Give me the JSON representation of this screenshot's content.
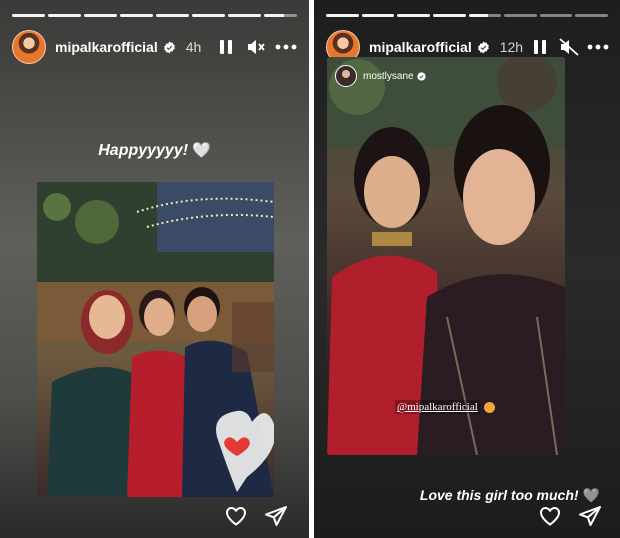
{
  "stories": [
    {
      "username": "mipalkarofficial",
      "time": "4h",
      "caption": "Happyyyyy!",
      "caption_emoji": "🤍",
      "progress_segments": 8,
      "progress_current": 8,
      "audio_state": "muted",
      "playback_state": "playing"
    },
    {
      "username": "mipalkarofficial",
      "time": "12h",
      "reposted_from": "mostlysane",
      "mention": "@mipalkarofficial",
      "caption": "Love this girl too much!",
      "caption_emoji": "🩶",
      "progress_segments": 8,
      "progress_current": 5,
      "audio_state": "muted",
      "playback_state": "playing"
    }
  ],
  "icons": {
    "pause": "pause-icon",
    "mute": "muted-speaker-icon",
    "more": "more-options-icon",
    "like": "heart-outline-icon",
    "share": "send-icon",
    "verified": "verified-badge-icon"
  },
  "colors": {
    "verified_badge": "#ffffff",
    "text": "#ffffff",
    "sticker_heart": "#e53935"
  }
}
